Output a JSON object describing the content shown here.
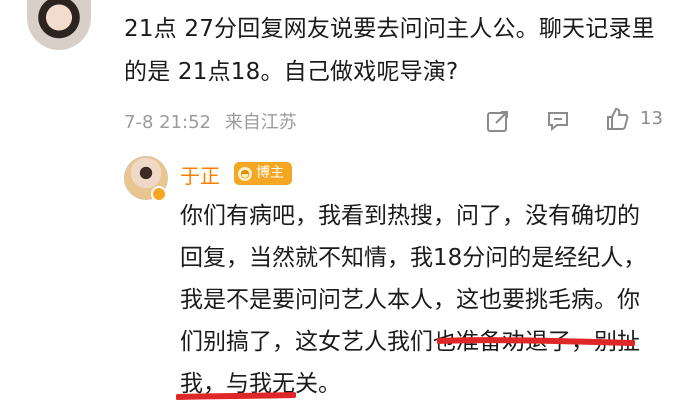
{
  "comments": [
    {
      "text": "21点 27分回复网友说要去问问主人公。聊天记录里的是 21点18。自己做戏呢导演?",
      "timestamp": "7-8 21:52",
      "location": "来自江苏",
      "like_count": "13",
      "icons": [
        "share-icon",
        "comment-icon",
        "like-icon"
      ]
    }
  ],
  "reply": {
    "username": "于正",
    "badge": "博主",
    "badge_icon": "bowl-icon",
    "text": "你们有病吧，我看到热搜，问了，没有确切的回复，当然就不知情，我18分问的是经纪人，我是不是要问问艺人本人，这也要挑毛病。你们别搞了，这女艺人我们也准备劝退了，别扯我，与我无关。"
  },
  "colors": {
    "username": "#ff7f00",
    "badge": "#f5a623",
    "underline": "#e02727",
    "meta": "#9b9b9b"
  }
}
